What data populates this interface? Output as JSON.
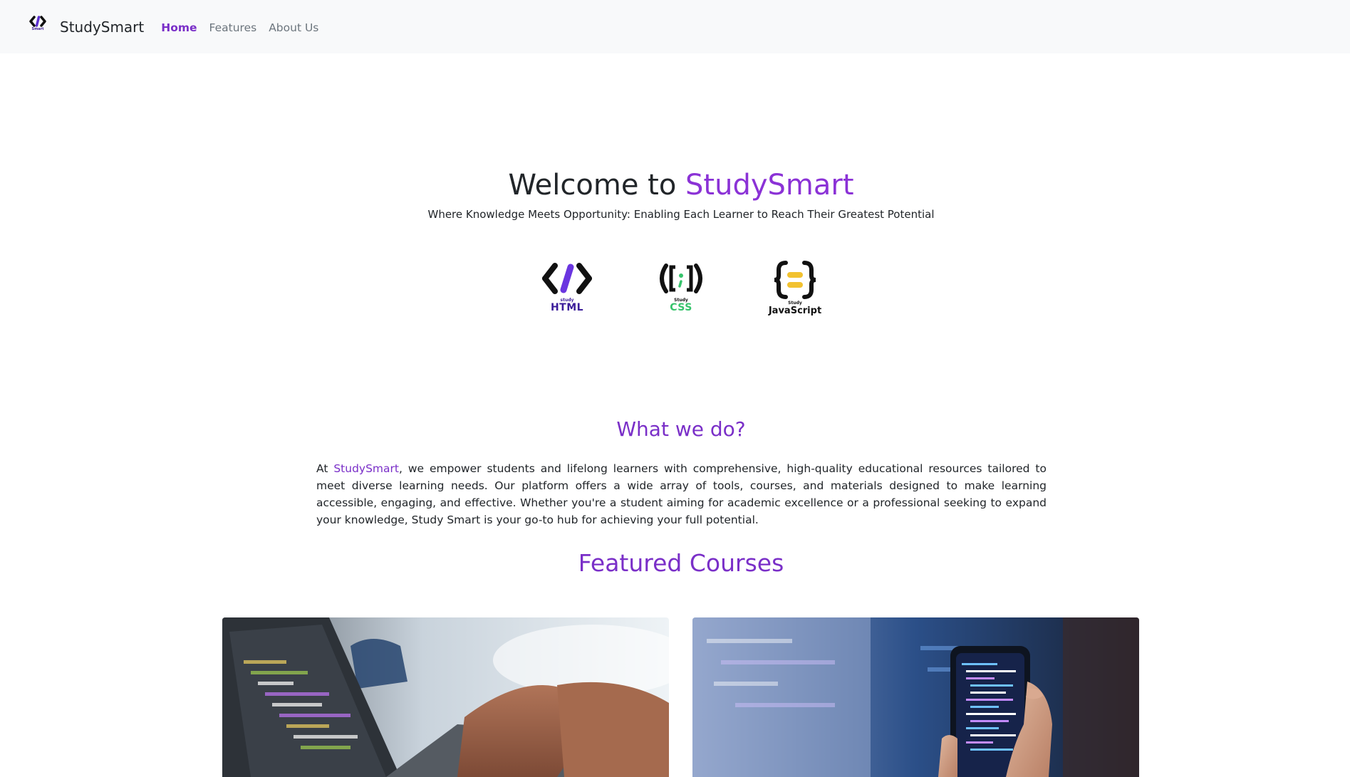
{
  "nav": {
    "brand_small": "Smart",
    "brand": "StudySmart",
    "links": [
      {
        "label": "Home",
        "active": true
      },
      {
        "label": "Features",
        "active": false
      },
      {
        "label": "About Us",
        "active": false
      }
    ]
  },
  "hero": {
    "title_prefix": "Welcome to ",
    "title_accent": "StudySmart",
    "subtitle": "Where Knowledge Meets Opportunity: Enabling Each Learner to Reach Their Greatest Potential",
    "logos": [
      {
        "icon": "html-code-icon",
        "small": "study",
        "label": "HTML"
      },
      {
        "icon": "css-brackets-icon",
        "small": "Study",
        "label": "CSS"
      },
      {
        "icon": "js-braces-icon",
        "small": "Study",
        "label": "JavaScript"
      }
    ]
  },
  "about": {
    "title": "What we do?",
    "body_prefix": "At ",
    "body_accent": "StudySmart",
    "body_rest": ", we empower students and lifelong learners with comprehensive, high-quality educational resources tailored to meet diverse learning needs. Our platform offers a wide array of tools, courses, and materials designed to make learning accessible, engaging, and effective. Whether you're a student aiming for academic excellence or a professional seeking to expand your knowledge, Study Smart is your go-to hub for achieving your full potential."
  },
  "courses": {
    "title": "Featured Courses",
    "cards": [
      {
        "image": "laptop-typing-photo"
      },
      {
        "image": "phone-code-photo"
      }
    ]
  },
  "colors": {
    "accent": "#8b32d6",
    "navbar_bg": "#f8f9fa",
    "css_green": "#36c36b",
    "js_yellow": "#f2c230"
  }
}
